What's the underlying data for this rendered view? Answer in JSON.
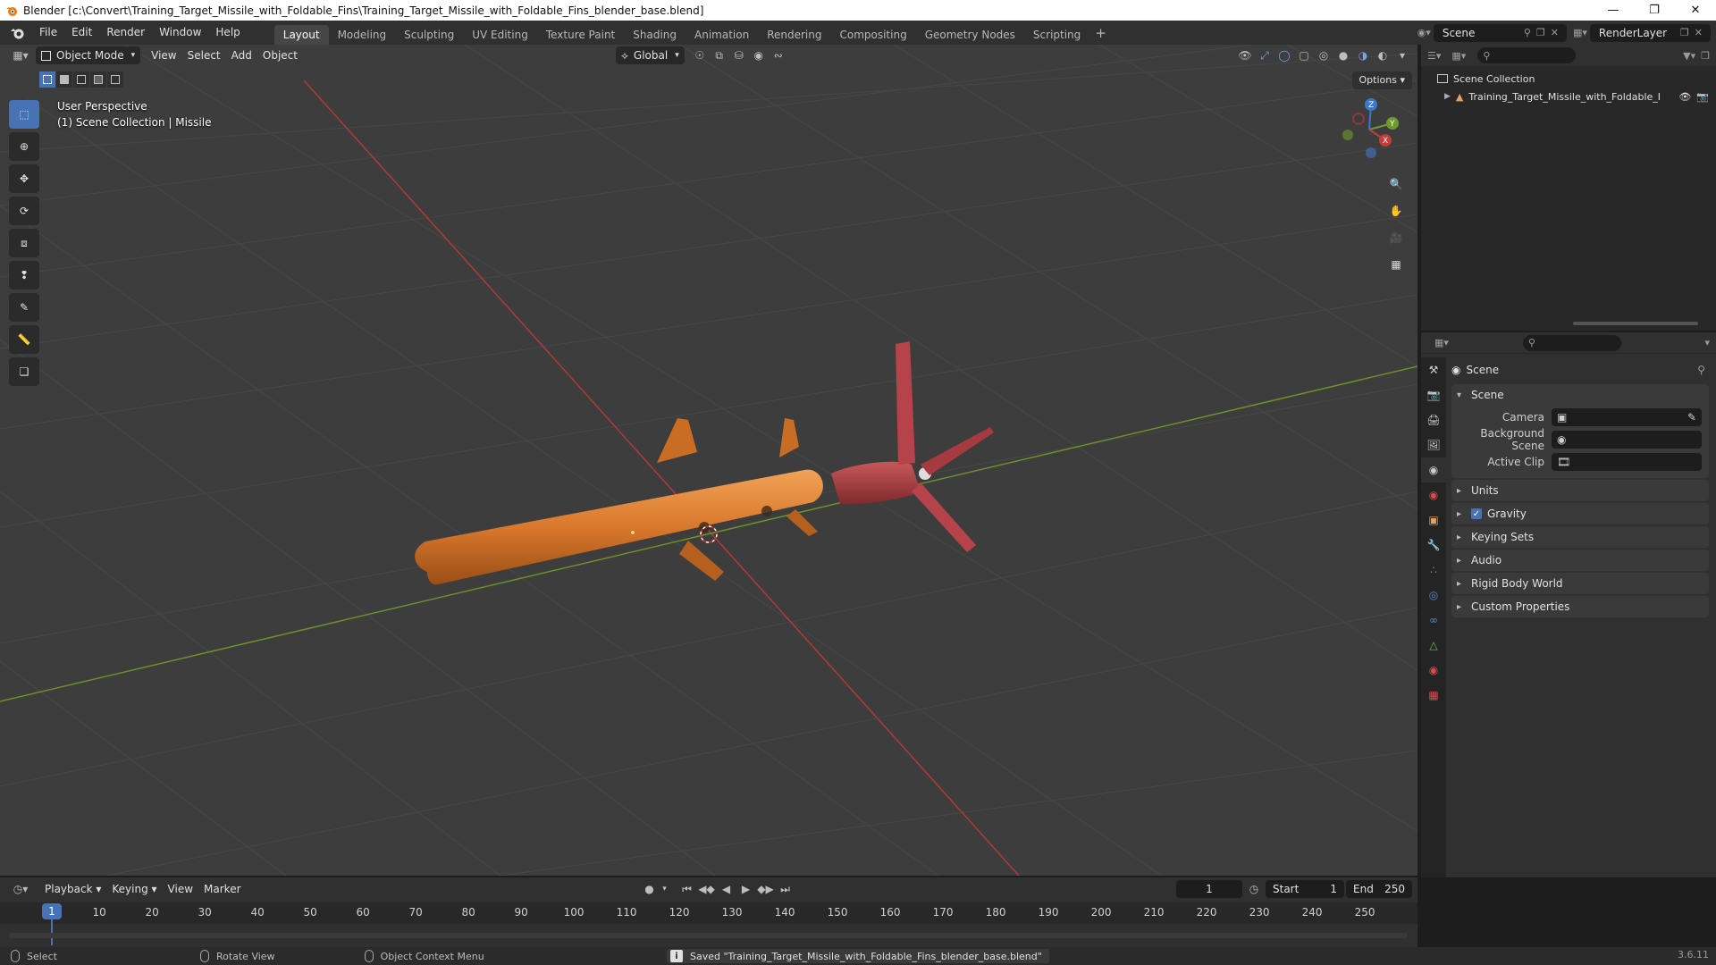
{
  "window": {
    "title": "Blender [c:\\Convert\\Training_Target_Missile_with_Foldable_Fins\\Training_Target_Missile_with_Foldable_Fins_blender_base.blend]"
  },
  "menubar": {
    "items": [
      "File",
      "Edit",
      "Render",
      "Window",
      "Help"
    ],
    "workspaces": [
      "Layout",
      "Modeling",
      "Sculpting",
      "UV Editing",
      "Texture Paint",
      "Shading",
      "Animation",
      "Rendering",
      "Compositing",
      "Geometry Nodes",
      "Scripting"
    ],
    "active_workspace": "Layout",
    "scene_name": "Scene",
    "view_layer": "RenderLayer"
  },
  "viewport": {
    "mode": "Object Mode",
    "menus": [
      "View",
      "Select",
      "Add",
      "Object"
    ],
    "transform_orientation": "Global",
    "options_label": "Options",
    "overlay_line1": "User Perspective",
    "overlay_line2": "(1) Scene Collection | Missile",
    "gizmo_axes": [
      "X",
      "Y",
      "Z"
    ]
  },
  "outliner": {
    "root": "Scene Collection",
    "items": [
      {
        "label": "Training_Target_Missile_with_Foldable_I"
      }
    ]
  },
  "properties": {
    "context_title": "Scene",
    "section": "Scene",
    "rows": [
      {
        "label": "Camera"
      },
      {
        "label": "Background Scene"
      },
      {
        "label": "Active Clip"
      }
    ],
    "panels": [
      {
        "label": "Units",
        "checkbox": false
      },
      {
        "label": "Gravity",
        "checkbox": true
      },
      {
        "label": "Keying Sets",
        "checkbox": false
      },
      {
        "label": "Audio",
        "checkbox": false
      },
      {
        "label": "Rigid Body World",
        "checkbox": false
      },
      {
        "label": "Custom Properties",
        "checkbox": false
      }
    ]
  },
  "timeline": {
    "menus": [
      "Playback",
      "Keying",
      "View",
      "Marker"
    ],
    "current_frame": "1",
    "start_label": "Start",
    "start": "1",
    "end_label": "End",
    "end": "250",
    "ticks": [
      "10",
      "20",
      "30",
      "40",
      "50",
      "60",
      "70",
      "80",
      "90",
      "100",
      "110",
      "120",
      "130",
      "140",
      "150",
      "160",
      "170",
      "180",
      "190",
      "200",
      "210",
      "220",
      "230",
      "240",
      "250"
    ]
  },
  "statusbar": {
    "select": "Select",
    "rotate": "Rotate View",
    "context_menu": "Object Context Menu",
    "message": "Saved \"Training_Target_Missile_with_Foldable_Fins_blender_base.blend\"",
    "version": "3.6.11"
  },
  "colors": {
    "accent": "#4772b3",
    "x_axis": "#c73a3a",
    "y_axis": "#6e9a2a",
    "missile": "#d9782c"
  }
}
